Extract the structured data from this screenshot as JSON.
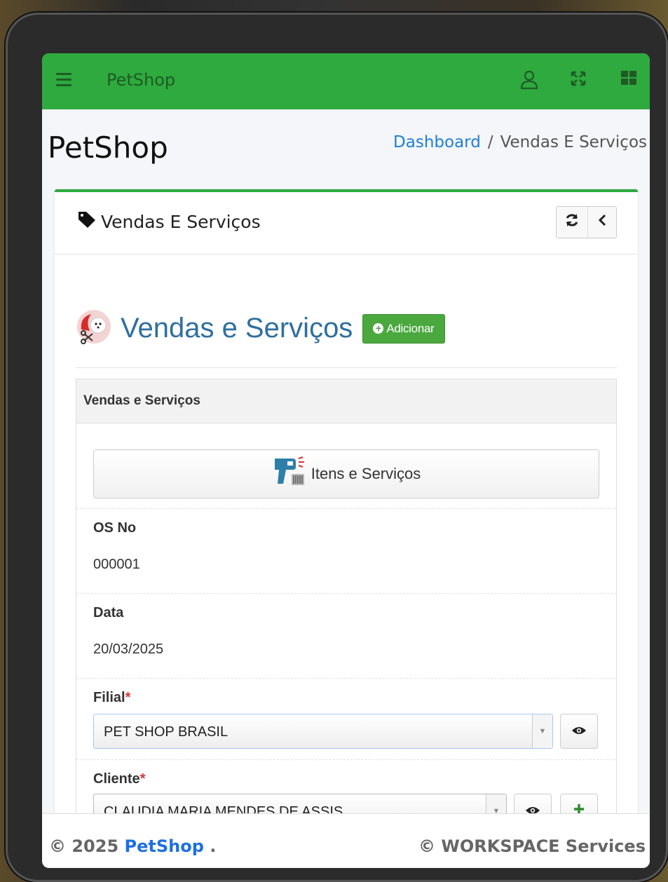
{
  "app": {
    "brand": "PetShop"
  },
  "page": {
    "title": "PetShop",
    "breadcrumb": {
      "home": "Dashboard",
      "separator": "/",
      "current": "Vendas E Serviços"
    }
  },
  "card": {
    "title": "Vendas E Serviços"
  },
  "section": {
    "title": "Vendas e Serviços",
    "add_label": "Adicionar"
  },
  "panel": {
    "heading": "Vendas e Serviços",
    "items_button": "Itens e Serviços",
    "fields": {
      "os_label": "OS No",
      "os_value": "000001",
      "date_label": "Data",
      "date_value": "20/03/2025",
      "filial_label": "Filial",
      "filial_value": "PET SHOP BRASIL",
      "cliente_label": "Cliente",
      "cliente_value": "CLAUDIA MARIA MENDES DE ASSIS",
      "required_mark": "*"
    }
  },
  "footer": {
    "copyright_prefix": "© 2025",
    "brand_link": "PetShop",
    "suffix": ".",
    "right": "© WORKSPACE Services"
  },
  "icons": [
    "menu-icon",
    "user-icon",
    "fullscreen-icon",
    "apps-grid-icon",
    "tag-icon",
    "refresh-icon",
    "chevron-left-icon",
    "pet-grooming-icon",
    "plus-circle-icon",
    "barcode-scanner-icon",
    "eye-icon",
    "plus-icon"
  ],
  "colors": {
    "topbar": "#2eaa3e",
    "accent_blue": "#1e7fd6",
    "section_title": "#2f6f9f",
    "add_button": "#4aa83e"
  }
}
